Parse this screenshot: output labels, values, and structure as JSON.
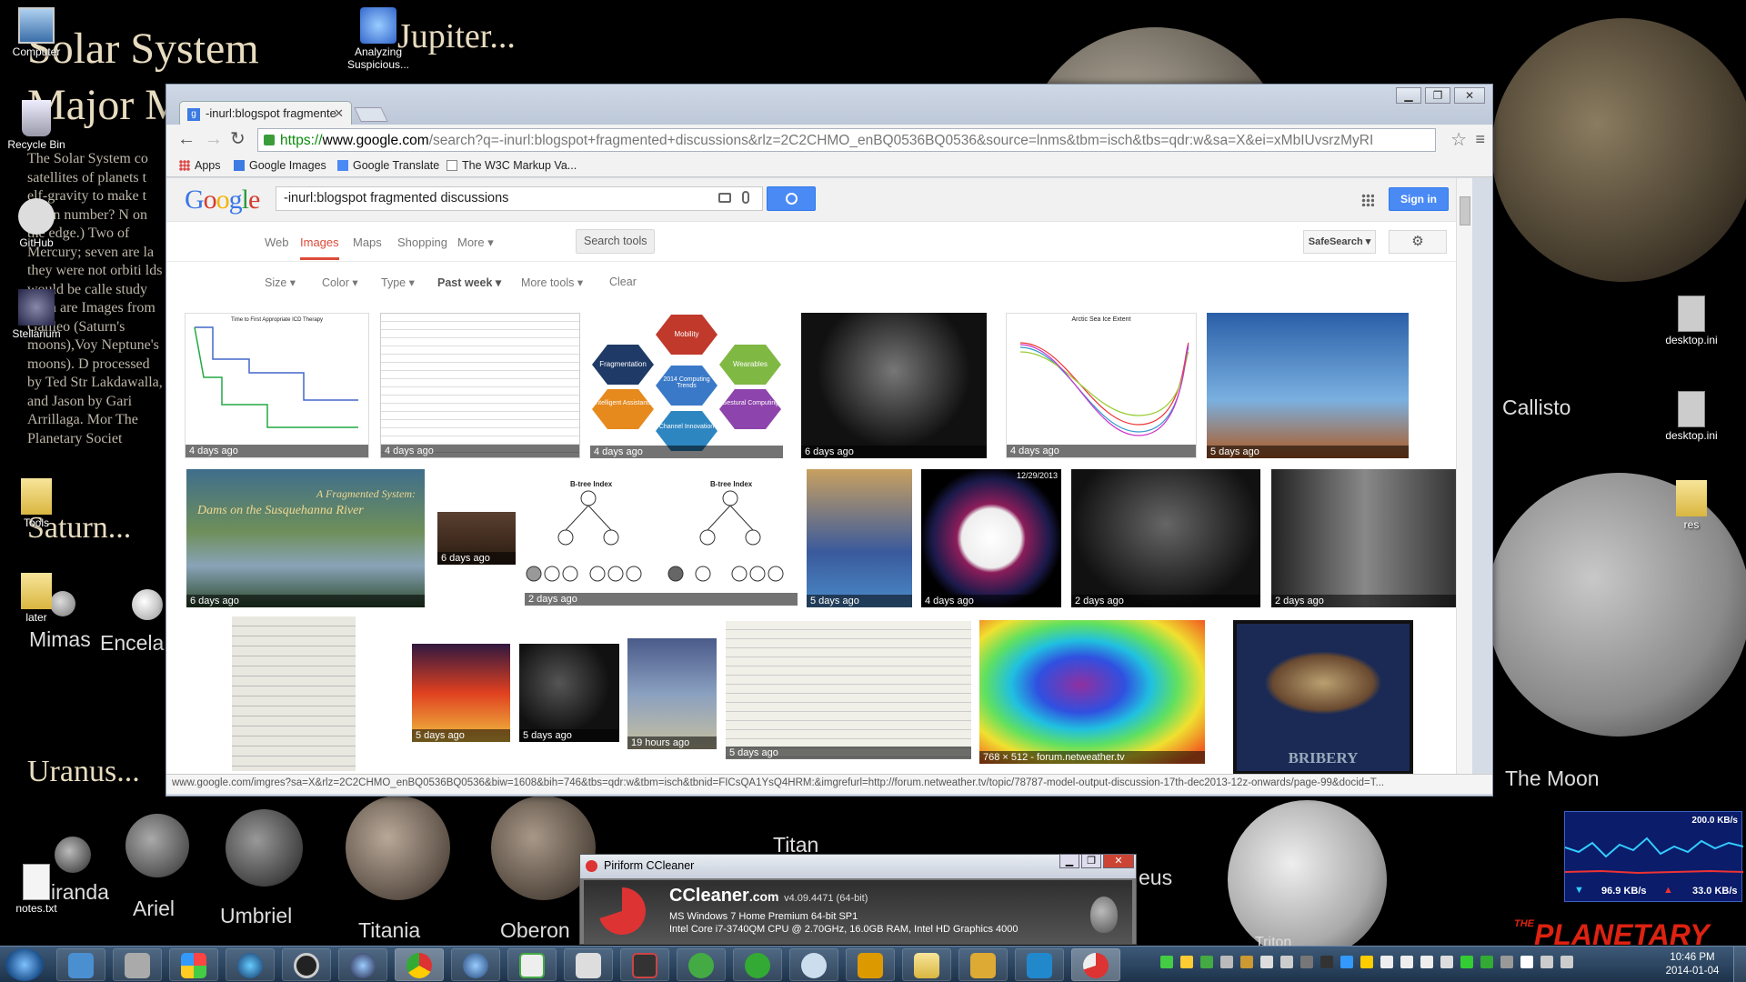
{
  "wallpaper": {
    "title_line1": "Solar System",
    "title_line2": "Major M",
    "jupiter_label": "Jupiter...",
    "saturn_label": "Saturn...",
    "uranus_label": "Uranus...",
    "body_text": "The Solar System co satellites of planets t elf-gravity to make t ertain number? N on the edge.) Two of Mercury; seven are la they were not orbiti lds would be calle study them are Images from Galileo (Saturn's moons),Voy Neptune's moons). D processed by Ted Str Lakdawalla, and Jason by Gari Arrillaga. Mor The Planetary Societ",
    "labels": {
      "callisto": "Callisto",
      "moon": "The Moon",
      "titan": "Titan",
      "mimas": "Mimas",
      "encel": "Encela",
      "miranda": "iranda",
      "ariel": "Ariel",
      "umbriel": "Umbriel",
      "titania": "Titania",
      "oberon": "Oberon",
      "neus": "eus",
      "triton": "Triton"
    },
    "planetary_logo": "PLANETARY",
    "planetary_the": "THE"
  },
  "desktop_icons": [
    {
      "label": "Computer"
    },
    {
      "label": "Analyzing Suspicious..."
    },
    {
      "label": "Recycle Bin"
    },
    {
      "label": "GitHub"
    },
    {
      "label": "Stellarium"
    },
    {
      "label": "Tools"
    },
    {
      "label": "later"
    },
    {
      "label": "notes.txt"
    },
    {
      "label": "desktop.ini"
    },
    {
      "label": "desktop.ini"
    },
    {
      "label": "res"
    }
  ],
  "browser": {
    "tab_title": "-inurl:blogspot fragmente",
    "tab_favicon": "g",
    "url_scheme": "https://",
    "url_host": "www.google.com",
    "url_rest": "/search?q=-inurl:blogspot+fragmented+discussions&rlz=2C2CHMO_enBQ0536BQ0536&source=lnms&tbm=isch&tbs=qdr:w&sa=X&ei=xMbIUvsrzMyRI",
    "bookmarks": [
      "Apps",
      "Google Images",
      "Google Translate",
      "The W3C Markup Va..."
    ],
    "status_url": "www.google.com/imgres?sa=X&rlz=2C2CHMO_enBQ0536BQ0536&biw=1608&bih=746&tbs=qdr:w&tbm=isch&tbnid=FICsQA1YsQ4HRM:&imgrefurl=http://forum.netweather.tv/topic/78787-model-output-discussion-17th-dec2013-12z-onwards/page-99&docid=T..."
  },
  "google": {
    "logo": "Google",
    "query": "-inurl:blogspot fragmented discussions",
    "signin": "Sign in",
    "tabs": [
      "Web",
      "Images",
      "Maps",
      "Shopping",
      "More ▾"
    ],
    "search_tools": "Search tools",
    "safesearch": "SafeSearch ▾",
    "filters": [
      "Size ▾",
      "Color ▾",
      "Type ▾",
      "Past week ▾",
      "More tools ▾",
      "Clear"
    ],
    "thumb_ages": {
      "r1": [
        "4 days ago",
        "4 days ago",
        "4 days ago",
        "6 days ago",
        "4 days ago",
        "5 days ago"
      ],
      "r2": [
        "6 days ago",
        "6 days ago",
        "2 days ago",
        "5 days ago",
        "4 days ago",
        "2 days ago",
        "2 days ago"
      ],
      "r3": [
        "5 days ago",
        "5 days ago",
        "19 hours ago",
        "5 days ago",
        "768 × 512 - forum.netweather.tv"
      ]
    },
    "thumb_texts": {
      "dams_title": "A Fragmented System:",
      "dams_sub": "Dams on the Susquehanna River",
      "btree_label": "B-tree Index",
      "bribery": "BRIBERY",
      "mobility": "Mobility",
      "fragmentation": "Fragmentation",
      "wearables": "Wearables",
      "trends": "2014 Computing Trends",
      "intelligent": "Intelligent Assistants",
      "gestural": "Gestural Computing",
      "channel": "Channel Innovation",
      "arctic": "Arctic Sea Ice Extent",
      "ttfat": "Time to First Appropriate ICD Therapy",
      "date_stamp": "12/29/2013"
    }
  },
  "ccleaner": {
    "title": "Piriform CCleaner",
    "name": "CCleaner",
    "dotcom": ".com",
    "version": "v4.09.4471 (64-bit)",
    "os": "MS Windows 7 Home Premium 64-bit SP1",
    "cpu": "Intel Core i7-3740QM CPU @ 2.70GHz, 16.0GB RAM, Intel HD Graphics 4000"
  },
  "netmeter": {
    "peak": "200.0 KB/s",
    "down": "96.9 KB/s",
    "up": "33.0 KB/s"
  },
  "taskbar": {
    "time": "10:46 PM",
    "date": "2014-01-04"
  }
}
